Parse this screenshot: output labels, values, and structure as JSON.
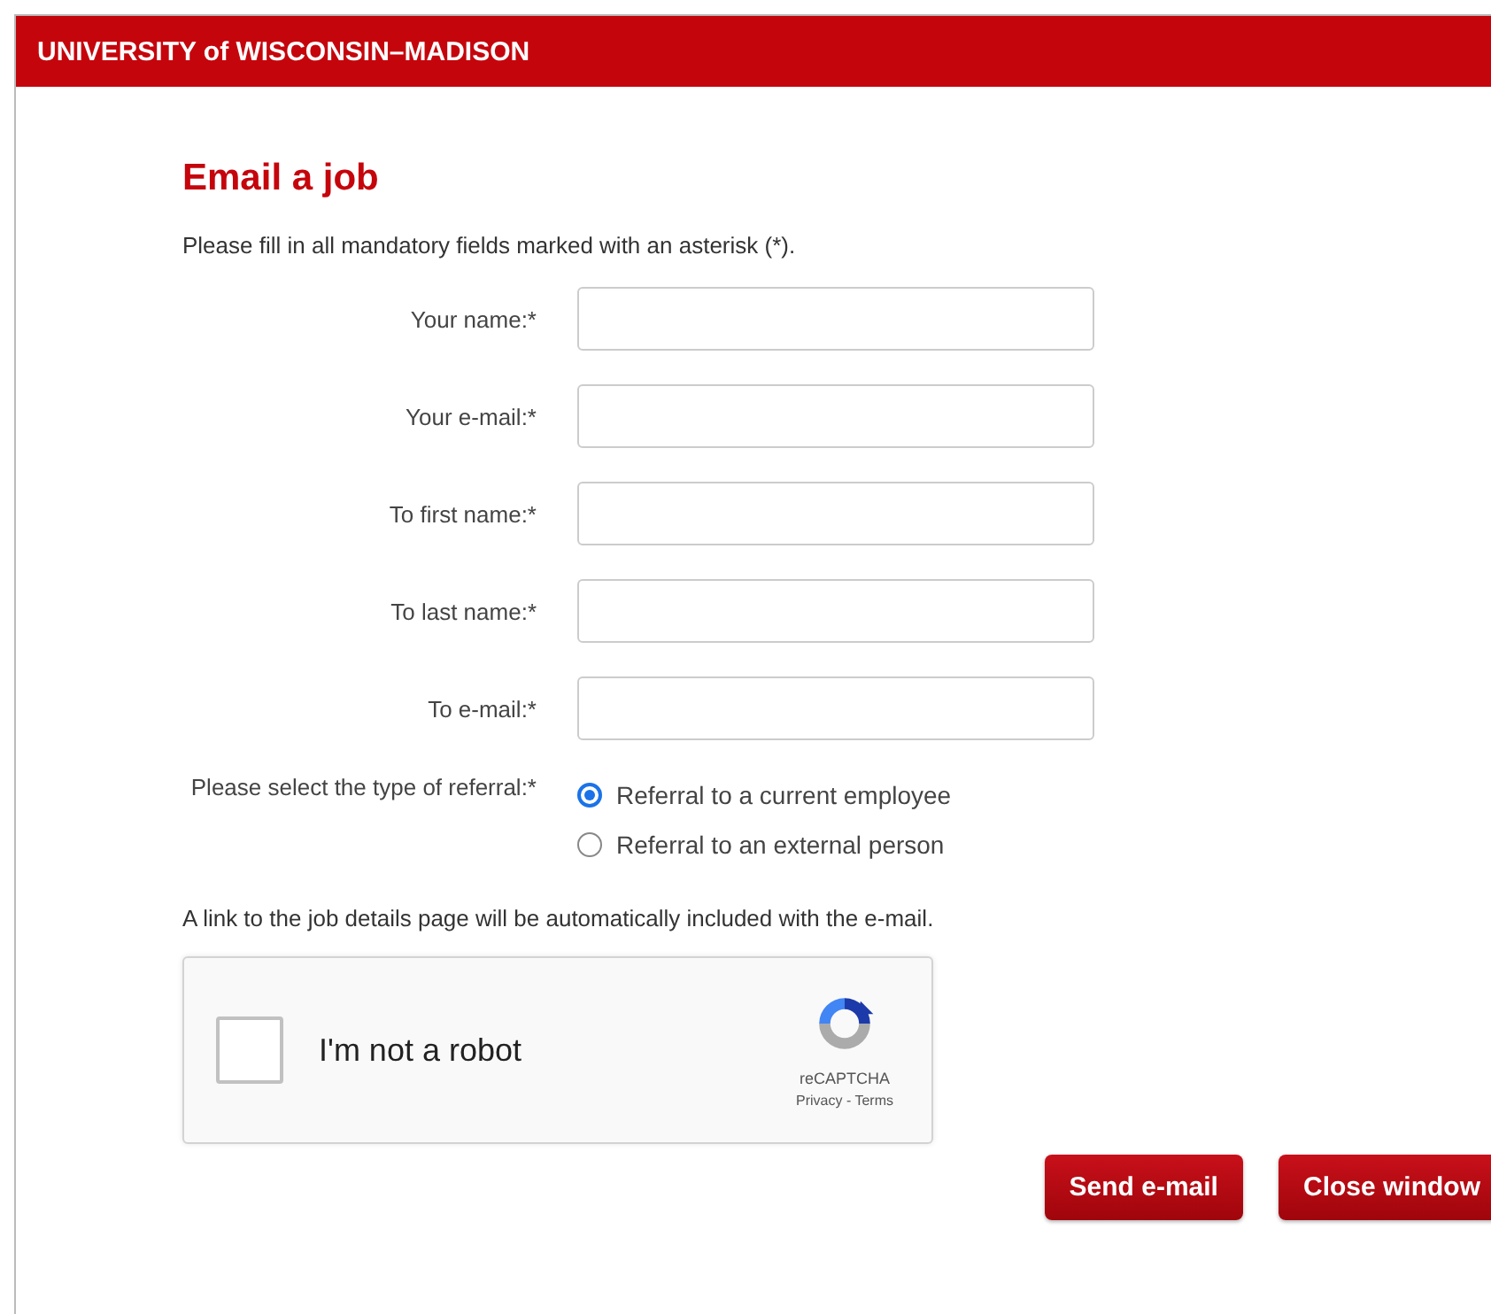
{
  "header": {
    "title": "UNIVERSITY of WISCONSIN–MADISON"
  },
  "heading": "Email a job",
  "instructions": "Please fill in all mandatory fields marked with an asterisk (*).",
  "fields": [
    {
      "label": "Your name:*"
    },
    {
      "label": "Your e-mail:*"
    },
    {
      "label": "To first name:*"
    },
    {
      "label": "To last name:*"
    },
    {
      "label": "To e-mail:*"
    }
  ],
  "referral": {
    "label": "Please select the type of referral:*",
    "options": [
      {
        "label": "Referral to a current employee",
        "selected": true
      },
      {
        "label": "Referral to an external person",
        "selected": false
      }
    ]
  },
  "note": "A link to the job details page will be automatically included with the e-mail.",
  "captcha": {
    "label": "I'm not a robot",
    "checked": false,
    "brand": "reCAPTCHA",
    "links": "Privacy - Terms"
  },
  "buttons": [
    "Send e-mail",
    "Close window"
  ]
}
